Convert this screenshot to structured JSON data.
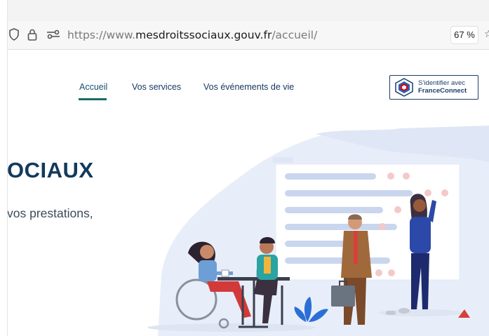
{
  "browser": {
    "url_prefix": "https://www.",
    "url_domain": "mesdroitssociaux.gouv.fr",
    "url_path": "/accueil/",
    "zoom": "67 %",
    "icons": [
      "shield-icon",
      "lock-icon",
      "permissions-icon",
      "favorite-star-icon"
    ]
  },
  "nav": {
    "items": [
      {
        "label": "Accueil"
      },
      {
        "label": "Vos services"
      },
      {
        "label": "Vos événements de vie"
      }
    ],
    "active": "Accueil"
  },
  "franceconnect": {
    "line1": "S’identifier avec",
    "line2": "FranceConnect"
  },
  "hero": {
    "headline": "OCIAUX",
    "subline": "vos prestations,"
  },
  "colors": {
    "navy": "#163860",
    "accent_teal": "#1b6b6b",
    "hero_bg": "#e8eef9",
    "fc_blue": "#1b3f6b"
  }
}
